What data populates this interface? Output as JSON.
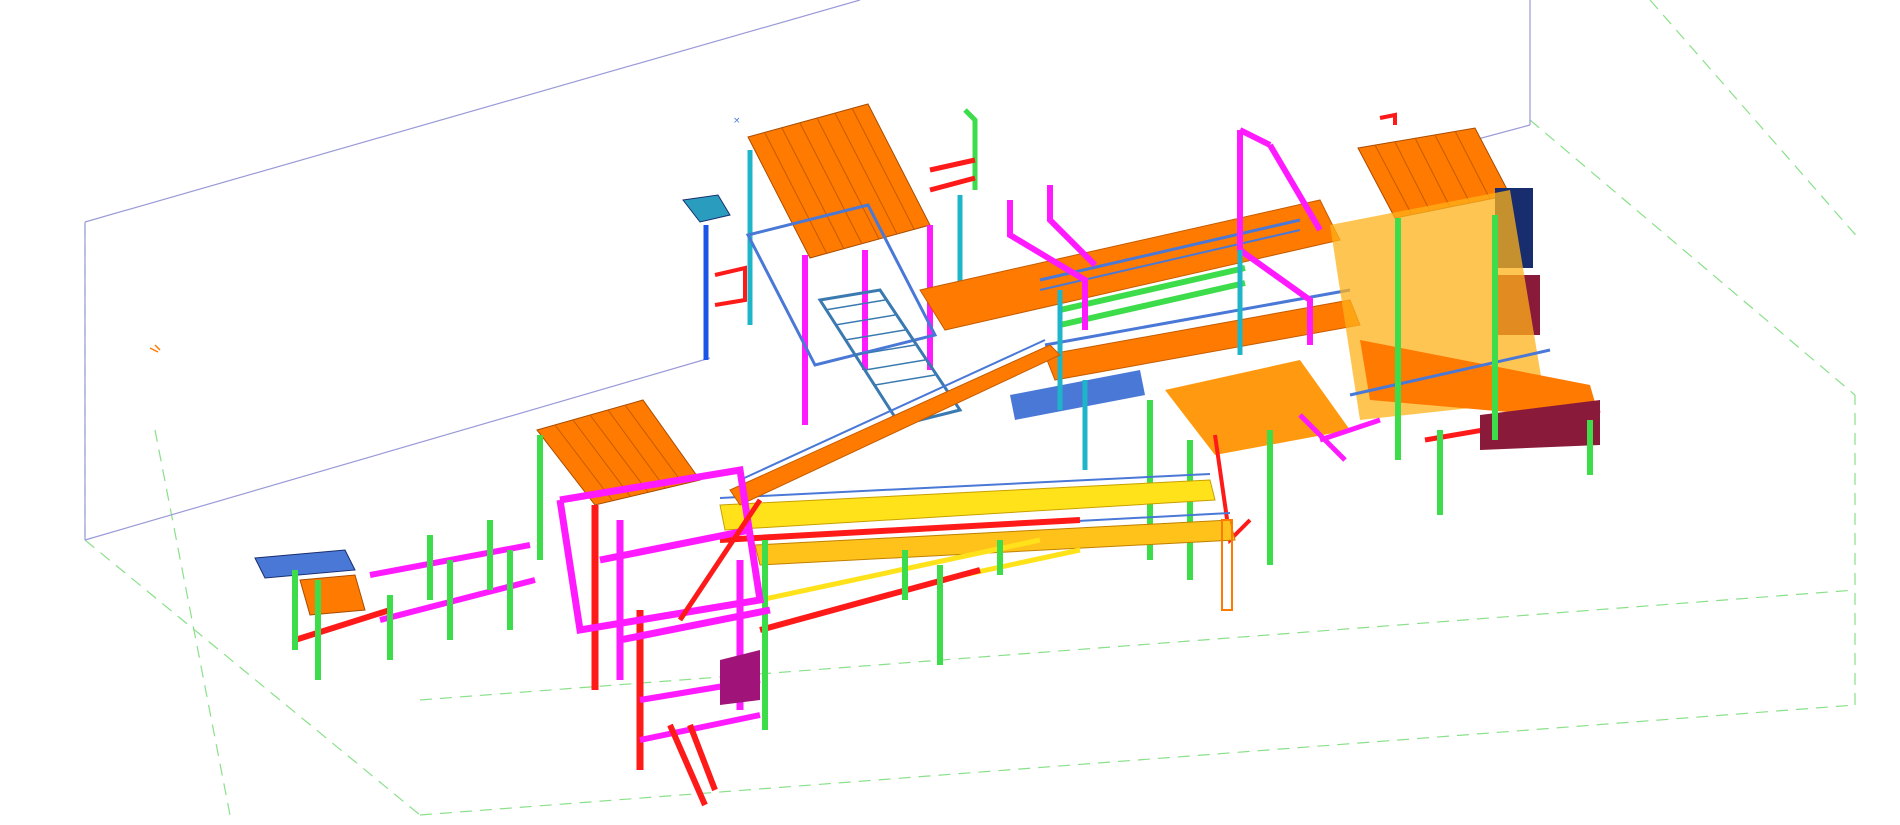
{
  "viewport": {
    "background": "#ffffff",
    "projection": "isometric",
    "render_mode": "colored-members"
  },
  "model": {
    "subject": "steel-structure-plant",
    "member_colors": {
      "column": "#3ddc4a",
      "beam": "#ff1a1a",
      "bracing": "#ff1aff",
      "roof-sheeting": "#ff7a00",
      "handrail": "#4a78d6",
      "conveyor-gallery": "#ffe21a",
      "cyan-column": "#1fb5c8",
      "blue-column": "#1a55e6",
      "dark-panel": "#182d6e",
      "maroon-panel": "#8a1a3a",
      "bounding-box": "#9a9ad8",
      "ground-grid": "#8ae08a"
    },
    "icons": [
      "axis-marker-icon",
      "origin-marker-icon"
    ]
  }
}
